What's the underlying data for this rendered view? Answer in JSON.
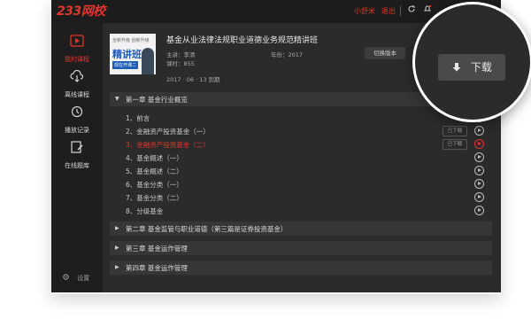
{
  "app": {
    "logo": "233网校",
    "username": "小舒米",
    "logout": "退出",
    "colors": {
      "accent": "#e0352b",
      "background": "#2b2b2b",
      "titlebar": "#1c1c1c"
    }
  },
  "sidebar": {
    "items": [
      {
        "label": "我的课程",
        "icon": "play-icon",
        "active": true
      },
      {
        "label": "离线课程",
        "icon": "cloud-download-icon",
        "active": false
      },
      {
        "label": "播放记录",
        "icon": "history-icon",
        "active": false
      },
      {
        "label": "在线题库",
        "icon": "edit-icon",
        "active": false
      }
    ],
    "settings_label": "设置"
  },
  "course": {
    "thumb_top": "全新升级   创新升级",
    "thumb_title": "精讲班",
    "thumb_tag": "现在开课二",
    "title": "基金从业法律法规职业道德业务规范精讲班",
    "teacher": "主讲：李清",
    "year": "年份：2017",
    "lessons": "课时：855",
    "updated": "2017 · 06 · 13 到期",
    "switch_version": "切换版本"
  },
  "magnifier": {
    "download_label": "下载"
  },
  "chapters": [
    {
      "label": "第一章  基金行业概览",
      "expanded": true
    },
    {
      "label": "第二章  基金监管与职业道德（第三篇是证券投资基金）",
      "expanded": false
    },
    {
      "label": "第三章  基金运作管理",
      "expanded": false
    },
    {
      "label": "第四章  基金运作管理",
      "expanded": false
    }
  ],
  "lessons": [
    {
      "label": "1、前言",
      "tag": "",
      "active": false
    },
    {
      "label": "2、金融资产投资基金（一）",
      "tag": "已下载",
      "active": false
    },
    {
      "label": "3、金融资产投资基金（二）",
      "tag": "已下载",
      "active": true
    },
    {
      "label": "4、基金概述（一）",
      "tag": "",
      "active": false
    },
    {
      "label": "5、基金概述（二）",
      "tag": "",
      "active": false
    },
    {
      "label": "6、基金分类（一）",
      "tag": "",
      "active": false
    },
    {
      "label": "7、基金分类（二）",
      "tag": "",
      "active": false
    },
    {
      "label": "8、分级基金",
      "tag": "",
      "active": false
    }
  ]
}
